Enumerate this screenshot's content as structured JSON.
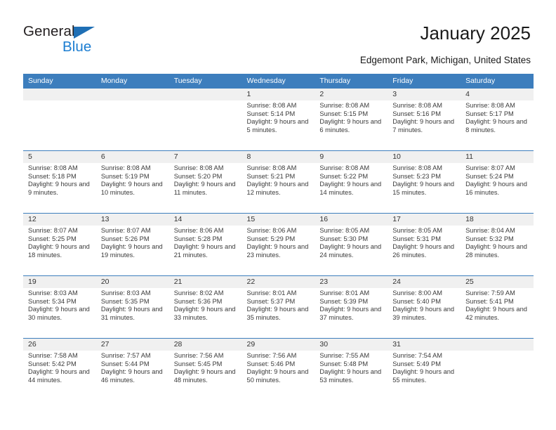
{
  "brand": {
    "name_part1": "General",
    "name_part2": "Blue",
    "triangle_color": "#1f6fb5",
    "blue_color": "#1b7dd1"
  },
  "header": {
    "title": "January 2025",
    "subtitle": "Edgemont Park, Michigan, United States"
  },
  "theme": {
    "header_blue": "#3d7ebd",
    "date_strip_gray": "#f0f0f0",
    "text_color": "#3a3a3a"
  },
  "calendar": {
    "weekday_headers": [
      "Sunday",
      "Monday",
      "Tuesday",
      "Wednesday",
      "Thursday",
      "Friday",
      "Saturday"
    ],
    "weeks": [
      [
        {
          "day": "",
          "empty": true
        },
        {
          "day": "",
          "empty": true
        },
        {
          "day": "",
          "empty": true
        },
        {
          "day": "1",
          "sunrise": "Sunrise: 8:08 AM",
          "sunset": "Sunset: 5:14 PM",
          "daylight": "Daylight: 9 hours and 5 minutes."
        },
        {
          "day": "2",
          "sunrise": "Sunrise: 8:08 AM",
          "sunset": "Sunset: 5:15 PM",
          "daylight": "Daylight: 9 hours and 6 minutes."
        },
        {
          "day": "3",
          "sunrise": "Sunrise: 8:08 AM",
          "sunset": "Sunset: 5:16 PM",
          "daylight": "Daylight: 9 hours and 7 minutes."
        },
        {
          "day": "4",
          "sunrise": "Sunrise: 8:08 AM",
          "sunset": "Sunset: 5:17 PM",
          "daylight": "Daylight: 9 hours and 8 minutes."
        }
      ],
      [
        {
          "day": "5",
          "sunrise": "Sunrise: 8:08 AM",
          "sunset": "Sunset: 5:18 PM",
          "daylight": "Daylight: 9 hours and 9 minutes."
        },
        {
          "day": "6",
          "sunrise": "Sunrise: 8:08 AM",
          "sunset": "Sunset: 5:19 PM",
          "daylight": "Daylight: 9 hours and 10 minutes."
        },
        {
          "day": "7",
          "sunrise": "Sunrise: 8:08 AM",
          "sunset": "Sunset: 5:20 PM",
          "daylight": "Daylight: 9 hours and 11 minutes."
        },
        {
          "day": "8",
          "sunrise": "Sunrise: 8:08 AM",
          "sunset": "Sunset: 5:21 PM",
          "daylight": "Daylight: 9 hours and 12 minutes."
        },
        {
          "day": "9",
          "sunrise": "Sunrise: 8:08 AM",
          "sunset": "Sunset: 5:22 PM",
          "daylight": "Daylight: 9 hours and 14 minutes."
        },
        {
          "day": "10",
          "sunrise": "Sunrise: 8:08 AM",
          "sunset": "Sunset: 5:23 PM",
          "daylight": "Daylight: 9 hours and 15 minutes."
        },
        {
          "day": "11",
          "sunrise": "Sunrise: 8:07 AM",
          "sunset": "Sunset: 5:24 PM",
          "daylight": "Daylight: 9 hours and 16 minutes."
        }
      ],
      [
        {
          "day": "12",
          "sunrise": "Sunrise: 8:07 AM",
          "sunset": "Sunset: 5:25 PM",
          "daylight": "Daylight: 9 hours and 18 minutes."
        },
        {
          "day": "13",
          "sunrise": "Sunrise: 8:07 AM",
          "sunset": "Sunset: 5:26 PM",
          "daylight": "Daylight: 9 hours and 19 minutes."
        },
        {
          "day": "14",
          "sunrise": "Sunrise: 8:06 AM",
          "sunset": "Sunset: 5:28 PM",
          "daylight": "Daylight: 9 hours and 21 minutes."
        },
        {
          "day": "15",
          "sunrise": "Sunrise: 8:06 AM",
          "sunset": "Sunset: 5:29 PM",
          "daylight": "Daylight: 9 hours and 23 minutes."
        },
        {
          "day": "16",
          "sunrise": "Sunrise: 8:05 AM",
          "sunset": "Sunset: 5:30 PM",
          "daylight": "Daylight: 9 hours and 24 minutes."
        },
        {
          "day": "17",
          "sunrise": "Sunrise: 8:05 AM",
          "sunset": "Sunset: 5:31 PM",
          "daylight": "Daylight: 9 hours and 26 minutes."
        },
        {
          "day": "18",
          "sunrise": "Sunrise: 8:04 AM",
          "sunset": "Sunset: 5:32 PM",
          "daylight": "Daylight: 9 hours and 28 minutes."
        }
      ],
      [
        {
          "day": "19",
          "sunrise": "Sunrise: 8:03 AM",
          "sunset": "Sunset: 5:34 PM",
          "daylight": "Daylight: 9 hours and 30 minutes."
        },
        {
          "day": "20",
          "sunrise": "Sunrise: 8:03 AM",
          "sunset": "Sunset: 5:35 PM",
          "daylight": "Daylight: 9 hours and 31 minutes."
        },
        {
          "day": "21",
          "sunrise": "Sunrise: 8:02 AM",
          "sunset": "Sunset: 5:36 PM",
          "daylight": "Daylight: 9 hours and 33 minutes."
        },
        {
          "day": "22",
          "sunrise": "Sunrise: 8:01 AM",
          "sunset": "Sunset: 5:37 PM",
          "daylight": "Daylight: 9 hours and 35 minutes."
        },
        {
          "day": "23",
          "sunrise": "Sunrise: 8:01 AM",
          "sunset": "Sunset: 5:39 PM",
          "daylight": "Daylight: 9 hours and 37 minutes."
        },
        {
          "day": "24",
          "sunrise": "Sunrise: 8:00 AM",
          "sunset": "Sunset: 5:40 PM",
          "daylight": "Daylight: 9 hours and 39 minutes."
        },
        {
          "day": "25",
          "sunrise": "Sunrise: 7:59 AM",
          "sunset": "Sunset: 5:41 PM",
          "daylight": "Daylight: 9 hours and 42 minutes."
        }
      ],
      [
        {
          "day": "26",
          "sunrise": "Sunrise: 7:58 AM",
          "sunset": "Sunset: 5:42 PM",
          "daylight": "Daylight: 9 hours and 44 minutes."
        },
        {
          "day": "27",
          "sunrise": "Sunrise: 7:57 AM",
          "sunset": "Sunset: 5:44 PM",
          "daylight": "Daylight: 9 hours and 46 minutes."
        },
        {
          "day": "28",
          "sunrise": "Sunrise: 7:56 AM",
          "sunset": "Sunset: 5:45 PM",
          "daylight": "Daylight: 9 hours and 48 minutes."
        },
        {
          "day": "29",
          "sunrise": "Sunrise: 7:56 AM",
          "sunset": "Sunset: 5:46 PM",
          "daylight": "Daylight: 9 hours and 50 minutes."
        },
        {
          "day": "30",
          "sunrise": "Sunrise: 7:55 AM",
          "sunset": "Sunset: 5:48 PM",
          "daylight": "Daylight: 9 hours and 53 minutes."
        },
        {
          "day": "31",
          "sunrise": "Sunrise: 7:54 AM",
          "sunset": "Sunset: 5:49 PM",
          "daylight": "Daylight: 9 hours and 55 minutes."
        },
        {
          "day": "",
          "empty": true
        }
      ]
    ]
  }
}
